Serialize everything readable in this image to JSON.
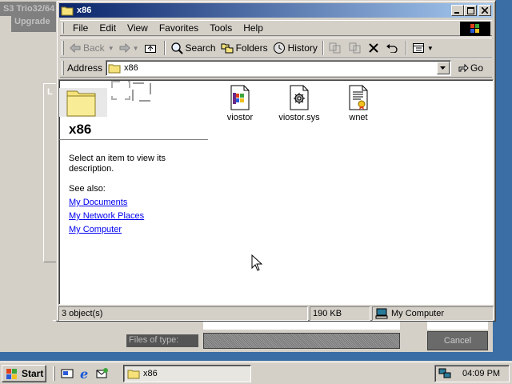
{
  "background_dialog": {
    "title": "S3 Trio32/64",
    "subtitle": "Upgrade",
    "inner_letter": "L",
    "files_of_type_label": "Files of type:",
    "cancel_label": "Cancel"
  },
  "window": {
    "title": "x86",
    "caption_buttons": [
      "minimize-icon",
      "maximize-icon",
      "close-icon"
    ]
  },
  "menu": [
    "File",
    "Edit",
    "View",
    "Favorites",
    "Tools",
    "Help"
  ],
  "toolbar": {
    "back": "Back",
    "search": "Search",
    "folders": "Folders",
    "history": "History"
  },
  "address": {
    "label": "Address",
    "value": "x86",
    "go": "Go"
  },
  "webview": {
    "folder_title": "x86",
    "description": "Select an item to view its description.",
    "see_also": "See also:",
    "links": [
      "My Documents",
      "My Network Places",
      "My Computer"
    ]
  },
  "files": [
    {
      "name": "viostor",
      "icon": "setup-information-icon"
    },
    {
      "name": "viostor.sys",
      "icon": "system-file-icon"
    },
    {
      "name": "wnet",
      "icon": "security-catalog-icon"
    }
  ],
  "status": {
    "objects": "3 object(s)",
    "size": "190 KB",
    "zone": "My Computer"
  },
  "taskbar": {
    "start": "Start",
    "task": "x86",
    "clock": "04:09 PM"
  },
  "colors": {
    "titlebar_start": "#0a246a",
    "titlebar_end": "#a6caf0",
    "desktop": "#3a6ea5",
    "face": "#d4d0c8",
    "link": "#0000ee"
  }
}
